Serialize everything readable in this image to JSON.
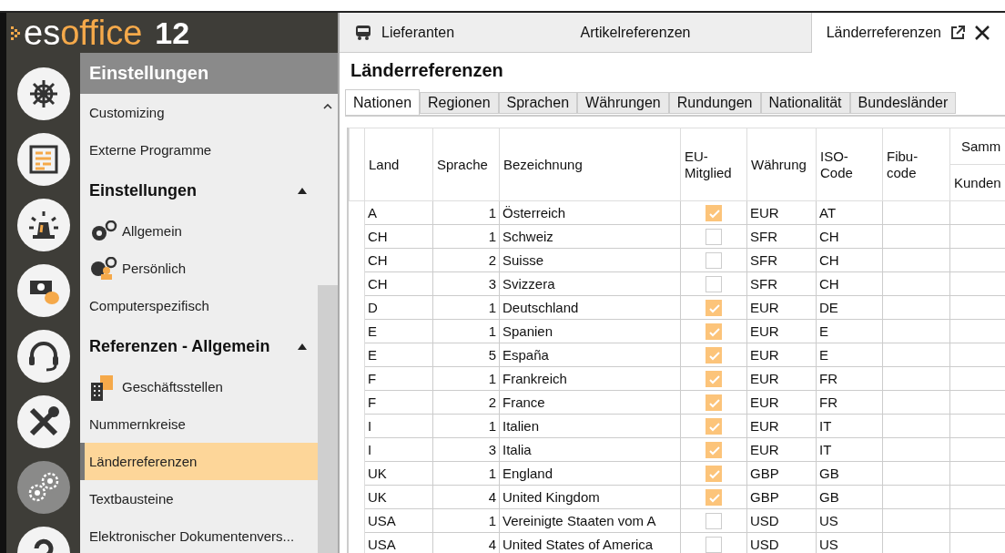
{
  "logo": {
    "prefix": "es",
    "name": "office",
    "version": "12"
  },
  "rail": [
    {
      "selected": false
    },
    {
      "selected": false
    },
    {
      "selected": false
    },
    {
      "selected": false
    },
    {
      "selected": false
    },
    {
      "selected": false
    },
    {
      "selected": true
    },
    {
      "selected": false
    }
  ],
  "sidebar": {
    "title": "Einstellungen",
    "items": [
      {
        "kind": "link",
        "label": "Customizing",
        "selected": false
      },
      {
        "kind": "link",
        "label": "Externe Programme",
        "selected": false
      },
      {
        "kind": "heading",
        "label": "Einstellungen",
        "expanded": true
      },
      {
        "kind": "gears",
        "label": "Allgemein",
        "selected": false
      },
      {
        "kind": "usergears",
        "label": "Persönlich",
        "selected": false
      },
      {
        "kind": "link",
        "label": "Computerspezifisch",
        "selected": false
      },
      {
        "kind": "heading",
        "label": "Referenzen - Allgemein",
        "expanded": true
      },
      {
        "kind": "building",
        "label": "Geschäftsstellen",
        "selected": false
      },
      {
        "kind": "link",
        "label": "Nummernkreise",
        "selected": false
      },
      {
        "kind": "link",
        "label": "Länderreferenzen",
        "selected": true
      },
      {
        "kind": "link",
        "label": "Textbausteine",
        "selected": false
      },
      {
        "kind": "link",
        "label": "Elektronischer Dokumentenvers...",
        "selected": false
      }
    ]
  },
  "tabs": [
    {
      "label": "Lieferanten",
      "selected": false
    },
    {
      "label": "Artikelreferenzen",
      "selected": false
    },
    {
      "label": "Länderreferenzen",
      "selected": true
    }
  ],
  "page_title": "Länderreferenzen",
  "subtabs": [
    {
      "label": "Nationen",
      "selected": true
    },
    {
      "label": "Regionen",
      "selected": false
    },
    {
      "label": "Sprachen",
      "selected": false
    },
    {
      "label": "Währungen",
      "selected": false
    },
    {
      "label": "Rundungen",
      "selected": false
    },
    {
      "label": "Nationalität",
      "selected": false
    },
    {
      "label": "Bundesländer",
      "selected": false
    }
  ],
  "table": {
    "columns": [
      "Land",
      "Sprache",
      "Bezeichnung",
      "EU-Mitglied",
      "Währung",
      "ISO-Code",
      "Fibu-code"
    ],
    "group_header": "Samm",
    "group_columns": [
      "Kunden"
    ],
    "rows": [
      {
        "land": "A",
        "sprache": "1",
        "bezeichnung": "Österreich",
        "eu": true,
        "waehrung": "EUR",
        "iso": "AT"
      },
      {
        "land": "CH",
        "sprache": "1",
        "bezeichnung": "Schweiz",
        "eu": false,
        "waehrung": "SFR",
        "iso": "CH"
      },
      {
        "land": "CH",
        "sprache": "2",
        "bezeichnung": "Suisse",
        "eu": false,
        "waehrung": "SFR",
        "iso": "CH"
      },
      {
        "land": "CH",
        "sprache": "3",
        "bezeichnung": "Svizzera",
        "eu": false,
        "waehrung": "SFR",
        "iso": "CH"
      },
      {
        "land": "D",
        "sprache": "1",
        "bezeichnung": "Deutschland",
        "eu": true,
        "waehrung": "EUR",
        "iso": "DE"
      },
      {
        "land": "E",
        "sprache": "1",
        "bezeichnung": "Spanien",
        "eu": true,
        "waehrung": "EUR",
        "iso": "E"
      },
      {
        "land": "E",
        "sprache": "5",
        "bezeichnung": "España",
        "eu": true,
        "waehrung": "EUR",
        "iso": "E"
      },
      {
        "land": "F",
        "sprache": "1",
        "bezeichnung": "Frankreich",
        "eu": true,
        "waehrung": "EUR",
        "iso": "FR"
      },
      {
        "land": "F",
        "sprache": "2",
        "bezeichnung": "France",
        "eu": true,
        "waehrung": "EUR",
        "iso": "FR"
      },
      {
        "land": "I",
        "sprache": "1",
        "bezeichnung": "Italien",
        "eu": true,
        "waehrung": "EUR",
        "iso": "IT"
      },
      {
        "land": "I",
        "sprache": "3",
        "bezeichnung": "Italia",
        "eu": true,
        "waehrung": "EUR",
        "iso": "IT"
      },
      {
        "land": "UK",
        "sprache": "1",
        "bezeichnung": "England",
        "eu": true,
        "waehrung": "GBP",
        "iso": "GB"
      },
      {
        "land": "UK",
        "sprache": "4",
        "bezeichnung": "United Kingdom",
        "eu": true,
        "waehrung": "GBP",
        "iso": "GB"
      },
      {
        "land": "USA",
        "sprache": "1",
        "bezeichnung": "Vereinigte Staaten vom A",
        "eu": false,
        "waehrung": "USD",
        "iso": "US"
      },
      {
        "land": "USA",
        "sprache": "4",
        "bezeichnung": "United States of America",
        "eu": false,
        "waehrung": "USD",
        "iso": "US"
      }
    ]
  }
}
